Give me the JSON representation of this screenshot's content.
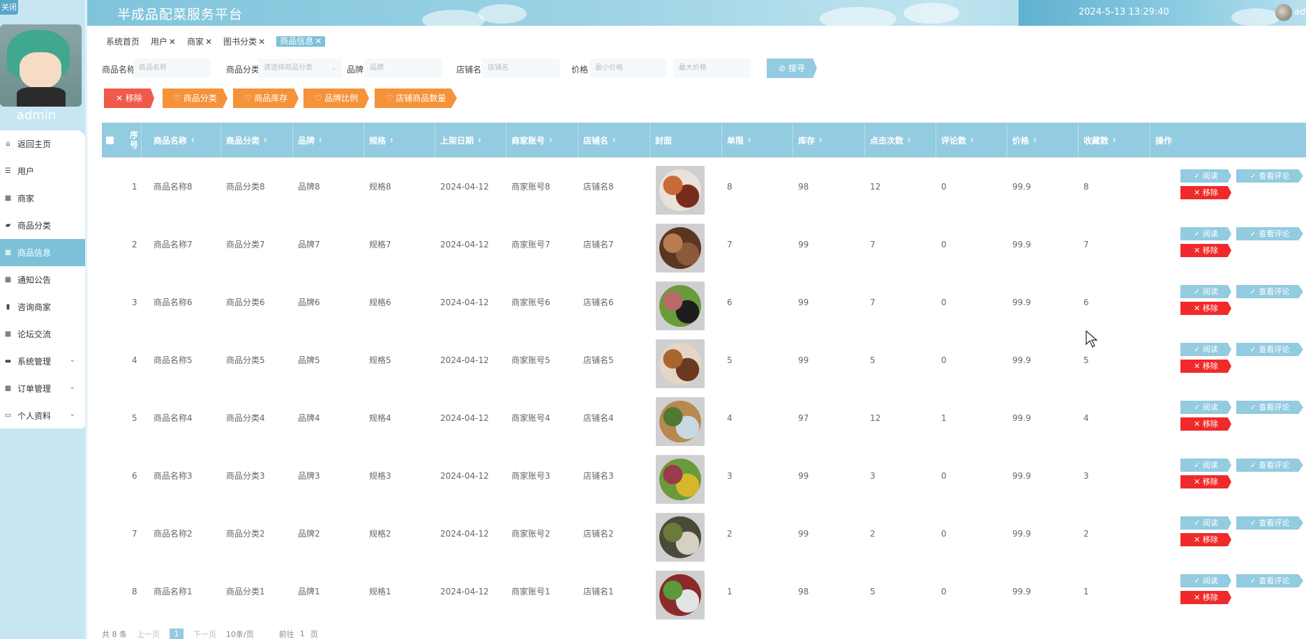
{
  "header": {
    "close_label": "关闭",
    "title": "半成品配菜服务平台",
    "datetime": "2024-5-13 13:29:40",
    "user": "adm"
  },
  "sidebar": {
    "username": "admin",
    "items": [
      {
        "label": "返回主页",
        "icon": "home-icon",
        "glyph": "⌂"
      },
      {
        "label": "用户",
        "icon": "user-list-icon",
        "glyph": "☰"
      },
      {
        "label": "商家",
        "icon": "grid-icon",
        "glyph": "▦"
      },
      {
        "label": "商品分类",
        "icon": "category-icon",
        "glyph": "▰"
      },
      {
        "label": "商品信息",
        "icon": "grid-icon",
        "glyph": "▦",
        "active": true
      },
      {
        "label": "通知公告",
        "icon": "grid-icon",
        "glyph": "▦"
      },
      {
        "label": "咨询商家",
        "icon": "bar-chart-icon",
        "glyph": "▮"
      },
      {
        "label": "论坛交流",
        "icon": "grid-icon",
        "glyph": "▦"
      },
      {
        "label": "系统管理",
        "icon": "monitor-icon",
        "glyph": "▬",
        "chevron": true
      },
      {
        "label": "订单管理",
        "icon": "grid-icon",
        "glyph": "▦",
        "chevron": true
      },
      {
        "label": "个人资料",
        "icon": "profile-icon",
        "glyph": "▭",
        "chevron": true
      }
    ]
  },
  "tabs": [
    {
      "label": "系统首页",
      "closable": false
    },
    {
      "label": "用户",
      "closable": true
    },
    {
      "label": "商家",
      "closable": true
    },
    {
      "label": "图书分类",
      "closable": true
    },
    {
      "label": "商品信息",
      "closable": true,
      "active": true
    }
  ],
  "search": {
    "name_label": "商品名称",
    "name_placeholder": "商品名称",
    "category_label": "商品分类",
    "category_placeholder": "请选择商品分类",
    "brand_label": "品牌",
    "brand_placeholder": "品牌",
    "shop_label": "店铺名",
    "shop_placeholder": "店铺名",
    "price_label": "价格",
    "price_min_placeholder": "最小价格",
    "price_max_placeholder": "最大价格",
    "search_button": "搜寻"
  },
  "actions": {
    "delete": "移除",
    "category": "商品分类",
    "stock": "商品库存",
    "brand_ratio": "品牌比例",
    "shop_count": "店铺商品数量"
  },
  "table": {
    "columns": [
      "序号",
      "商品名称",
      "商品分类",
      "品牌",
      "规格",
      "上架日期",
      "商家账号",
      "店铺名",
      "封面",
      "单限",
      "库存",
      "点击次数",
      "评论数",
      "价格",
      "收藏数",
      "操作"
    ],
    "row_actions": {
      "read": "阅读",
      "review": "查看评论",
      "delete": "移除"
    },
    "rows": [
      {
        "no": "1",
        "name": "商品名称8",
        "category": "商品分类8",
        "brand": "品牌8",
        "spec": "规格8",
        "date": "2024-04-12",
        "merchant": "商家账号8",
        "shop": "店铺名8",
        "limit": "8",
        "stock": "98",
        "clicks": "12",
        "comments": "0",
        "price": "99.9",
        "favorites": "8"
      },
      {
        "no": "2",
        "name": "商品名称7",
        "category": "商品分类7",
        "brand": "品牌7",
        "spec": "规格7",
        "date": "2024-04-12",
        "merchant": "商家账号7",
        "shop": "店铺名7",
        "limit": "7",
        "stock": "99",
        "clicks": "7",
        "comments": "0",
        "price": "99.9",
        "favorites": "7"
      },
      {
        "no": "3",
        "name": "商品名称6",
        "category": "商品分类6",
        "brand": "品牌6",
        "spec": "规格6",
        "date": "2024-04-12",
        "merchant": "商家账号6",
        "shop": "店铺名6",
        "limit": "6",
        "stock": "99",
        "clicks": "7",
        "comments": "0",
        "price": "99.9",
        "favorites": "6"
      },
      {
        "no": "4",
        "name": "商品名称5",
        "category": "商品分类5",
        "brand": "品牌5",
        "spec": "规格5",
        "date": "2024-04-12",
        "merchant": "商家账号5",
        "shop": "店铺名5",
        "limit": "5",
        "stock": "99",
        "clicks": "5",
        "comments": "0",
        "price": "99.9",
        "favorites": "5"
      },
      {
        "no": "5",
        "name": "商品名称4",
        "category": "商品分类4",
        "brand": "品牌4",
        "spec": "规格4",
        "date": "2024-04-12",
        "merchant": "商家账号4",
        "shop": "店铺名4",
        "limit": "4",
        "stock": "97",
        "clicks": "12",
        "comments": "1",
        "price": "99.9",
        "favorites": "4"
      },
      {
        "no": "6",
        "name": "商品名称3",
        "category": "商品分类3",
        "brand": "品牌3",
        "spec": "规格3",
        "date": "2024-04-12",
        "merchant": "商家账号3",
        "shop": "店铺名3",
        "limit": "3",
        "stock": "99",
        "clicks": "3",
        "comments": "0",
        "price": "99.9",
        "favorites": "3"
      },
      {
        "no": "7",
        "name": "商品名称2",
        "category": "商品分类2",
        "brand": "品牌2",
        "spec": "规格2",
        "date": "2024-04-12",
        "merchant": "商家账号2",
        "shop": "店铺名2",
        "limit": "2",
        "stock": "99",
        "clicks": "2",
        "comments": "0",
        "price": "99.9",
        "favorites": "2"
      },
      {
        "no": "8",
        "name": "商品名称1",
        "category": "商品分类1",
        "brand": "品牌1",
        "spec": "规格1",
        "date": "2024-04-12",
        "merchant": "商家账号1",
        "shop": "店铺名1",
        "limit": "1",
        "stock": "98",
        "clicks": "5",
        "comments": "0",
        "price": "99.9",
        "favorites": "1"
      }
    ]
  },
  "pager": {
    "total": "共 8 条",
    "prev": "上一页",
    "current": "1",
    "next": "下一页",
    "page_size": "10条/页",
    "goto": "前往",
    "goto_value": "1",
    "page_unit": "页"
  },
  "colors": {
    "accent": "#93cbe0",
    "active_menu": "#7cc1d8",
    "danger": "#f02a2a",
    "warning": "#f5923a"
  }
}
